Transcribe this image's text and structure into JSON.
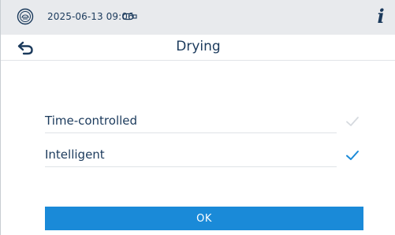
{
  "status": {
    "datetime": "2025-06-13 09:06",
    "logo_icon": "sterilizer-logo-icon",
    "usb_icon": "usb-stick-icon",
    "info_label": "i"
  },
  "header": {
    "back_icon": "back-arrow-icon",
    "title": "Drying"
  },
  "options": [
    {
      "label": "Time-controlled",
      "selected": false
    },
    {
      "label": "Intelligent",
      "selected": true
    }
  ],
  "ok_label": "OK",
  "colors": {
    "accent": "#1a8ad8",
    "text": "#1b3a5c",
    "statusbar_bg": "#e8eaed",
    "check_inactive": "#d6dadf"
  }
}
